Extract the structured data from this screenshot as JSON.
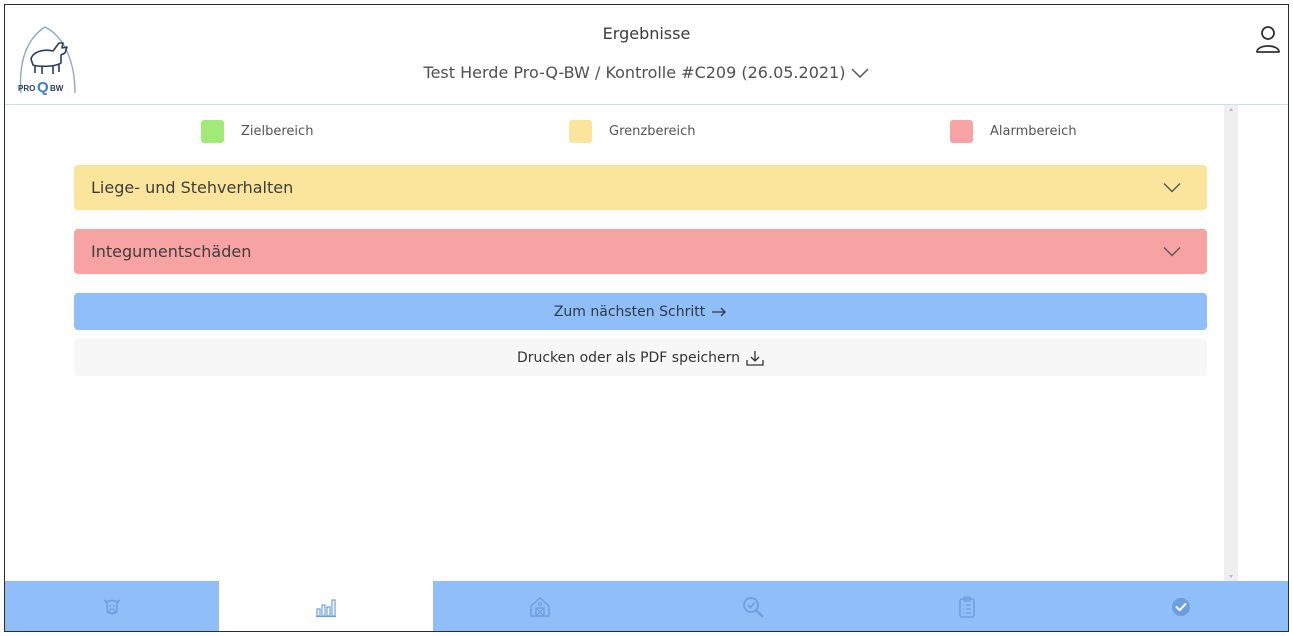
{
  "header": {
    "logo_text_left": "PRO",
    "logo_text_q": "Q",
    "logo_text_right": "BW",
    "title": "Ergebnisse",
    "herd_selector": "Test Herde Pro-Q-BW / Kontrolle #C209 (26.05.2021)"
  },
  "legend": [
    {
      "label": "Zielbereich",
      "color": "#a0ea77"
    },
    {
      "label": "Grenzbereich",
      "color": "#fbe59c"
    },
    {
      "label": "Alarmbereich",
      "color": "#f8a3a3"
    }
  ],
  "panels": [
    {
      "label": "Liege- und Stehverhalten",
      "color": "#fbe59c"
    },
    {
      "label": "Integumentschäden",
      "color": "#f8a3a3"
    }
  ],
  "actions": {
    "next_step": "Zum nächsten Schritt",
    "print_pdf": "Drucken oder als PDF speichern"
  },
  "bottom_nav": [
    {
      "icon": "cow-icon",
      "active": false
    },
    {
      "icon": "bar-chart-icon",
      "active": true
    },
    {
      "icon": "barn-icon",
      "active": false
    },
    {
      "icon": "magnifier-icon",
      "active": false
    },
    {
      "icon": "clipboard-icon",
      "active": false
    },
    {
      "icon": "check-circle-icon",
      "active": false
    }
  ],
  "colors": {
    "accent_blue": "#8fbef9",
    "icon_color": "#6d9fdd"
  }
}
